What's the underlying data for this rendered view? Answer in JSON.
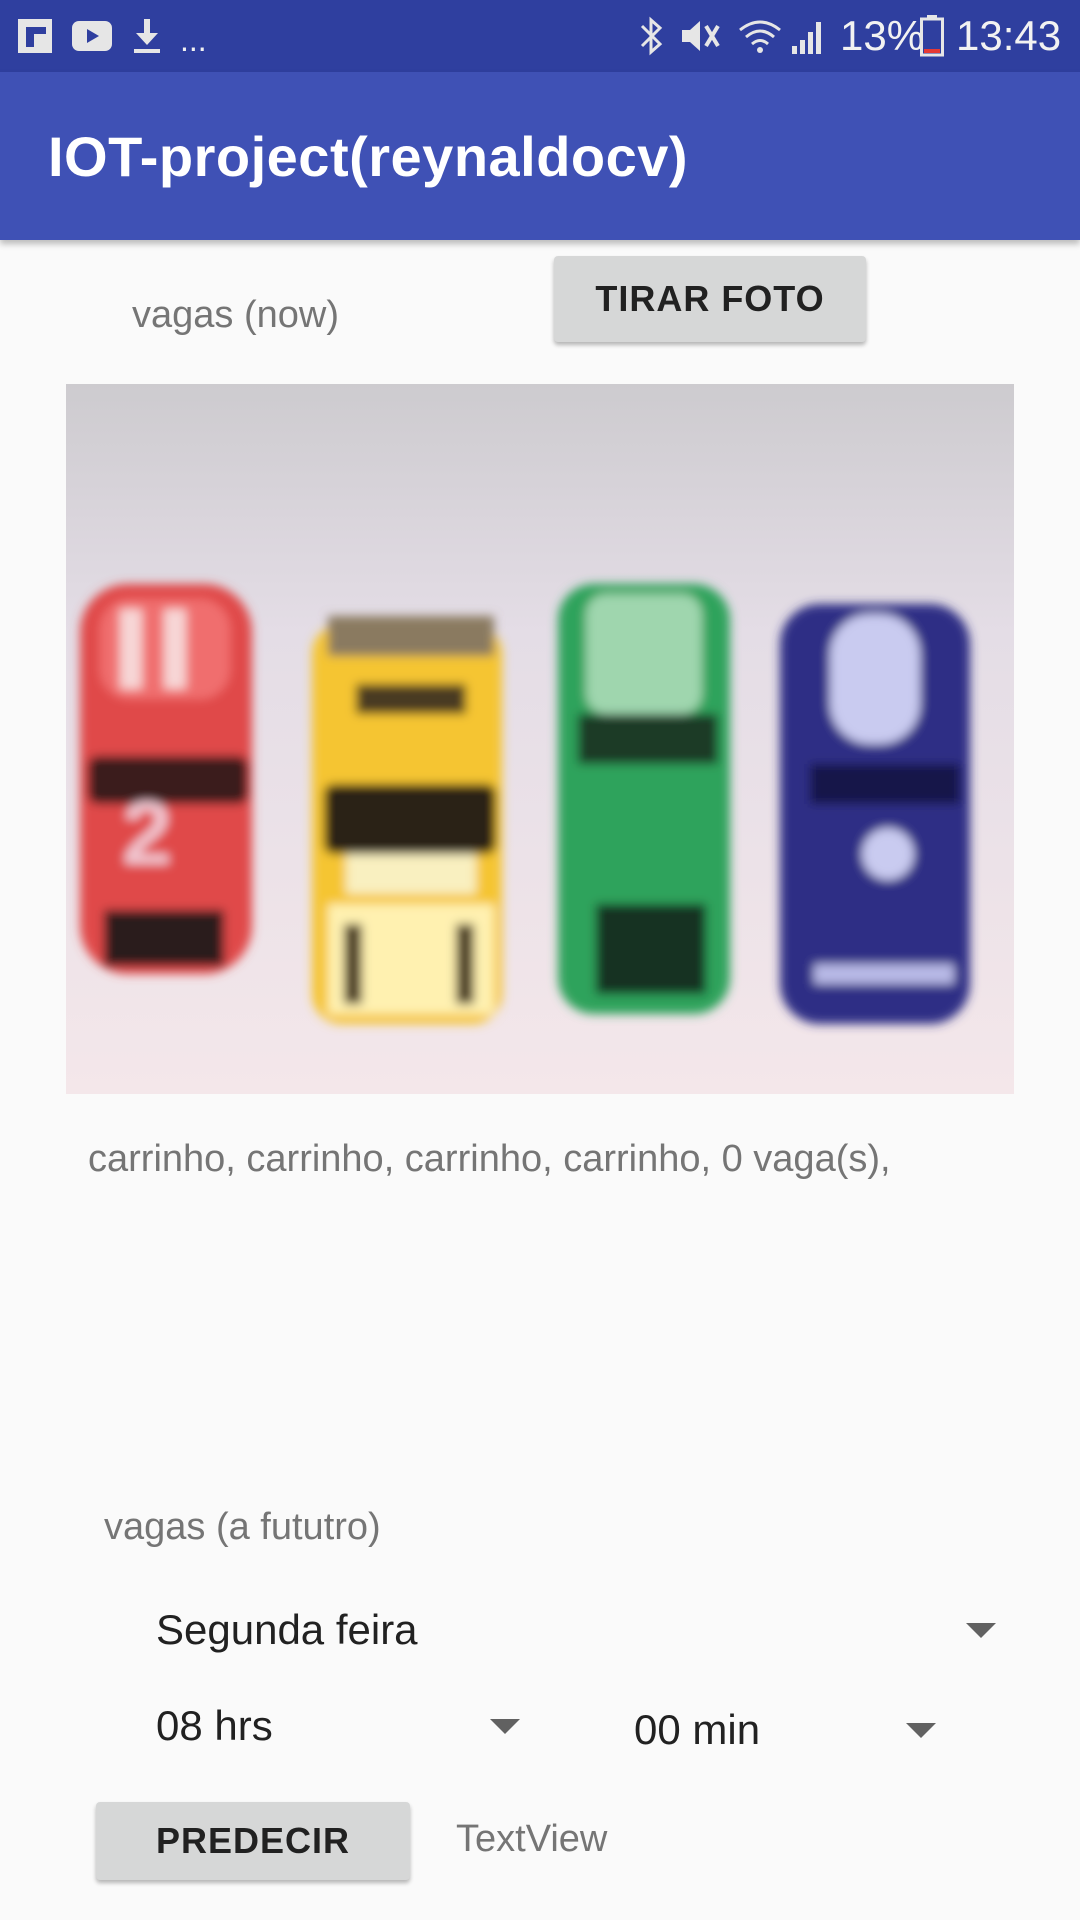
{
  "status_bar": {
    "battery": "13%",
    "time": "13:43",
    "overflow": "...",
    "icons": [
      "flipboard-icon",
      "youtube-icon",
      "download-icon",
      "bluetooth-icon",
      "mute-icon",
      "wifi-icon",
      "signal-icon",
      "battery-icon"
    ]
  },
  "app": {
    "title": "IOT-project(reynaldocv)"
  },
  "now_section": {
    "label": "vagas (now)",
    "take_photo_button": "TIRAR FOTO",
    "result_text": "carrinho, carrinho, carrinho, carrinho, 0 vaga(s),"
  },
  "future_section": {
    "label": "vagas (a fututro)",
    "day_selected": "Segunda feira",
    "hour_selected": "08 hrs",
    "minute_selected": "00 min",
    "predict_button": "PREDECIR",
    "result_text": "TextView"
  },
  "colors": {
    "status_bar": "#2f3f9f",
    "toolbar": "#3f51b5",
    "background": "#fafafa",
    "button": "#d6d7d7"
  }
}
